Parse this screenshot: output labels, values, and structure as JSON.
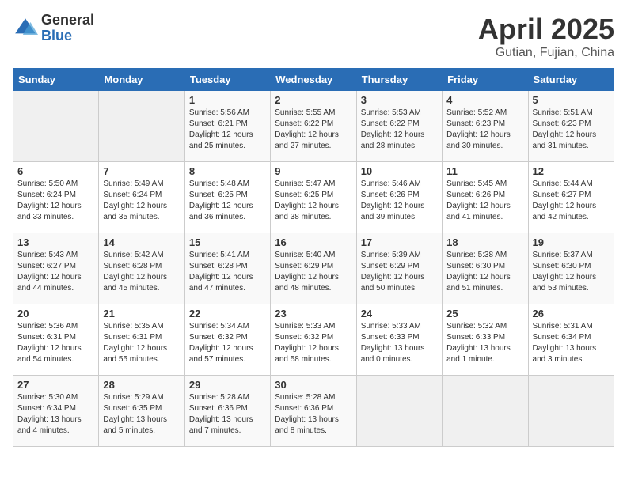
{
  "header": {
    "logo_general": "General",
    "logo_blue": "Blue",
    "month_title": "April 2025",
    "subtitle": "Gutian, Fujian, China"
  },
  "days_of_week": [
    "Sunday",
    "Monday",
    "Tuesday",
    "Wednesday",
    "Thursday",
    "Friday",
    "Saturday"
  ],
  "weeks": [
    [
      {
        "day": "",
        "info": ""
      },
      {
        "day": "",
        "info": ""
      },
      {
        "day": "1",
        "info": "Sunrise: 5:56 AM\nSunset: 6:21 PM\nDaylight: 12 hours and 25 minutes."
      },
      {
        "day": "2",
        "info": "Sunrise: 5:55 AM\nSunset: 6:22 PM\nDaylight: 12 hours and 27 minutes."
      },
      {
        "day": "3",
        "info": "Sunrise: 5:53 AM\nSunset: 6:22 PM\nDaylight: 12 hours and 28 minutes."
      },
      {
        "day": "4",
        "info": "Sunrise: 5:52 AM\nSunset: 6:23 PM\nDaylight: 12 hours and 30 minutes."
      },
      {
        "day": "5",
        "info": "Sunrise: 5:51 AM\nSunset: 6:23 PM\nDaylight: 12 hours and 31 minutes."
      }
    ],
    [
      {
        "day": "6",
        "info": "Sunrise: 5:50 AM\nSunset: 6:24 PM\nDaylight: 12 hours and 33 minutes."
      },
      {
        "day": "7",
        "info": "Sunrise: 5:49 AM\nSunset: 6:24 PM\nDaylight: 12 hours and 35 minutes."
      },
      {
        "day": "8",
        "info": "Sunrise: 5:48 AM\nSunset: 6:25 PM\nDaylight: 12 hours and 36 minutes."
      },
      {
        "day": "9",
        "info": "Sunrise: 5:47 AM\nSunset: 6:25 PM\nDaylight: 12 hours and 38 minutes."
      },
      {
        "day": "10",
        "info": "Sunrise: 5:46 AM\nSunset: 6:26 PM\nDaylight: 12 hours and 39 minutes."
      },
      {
        "day": "11",
        "info": "Sunrise: 5:45 AM\nSunset: 6:26 PM\nDaylight: 12 hours and 41 minutes."
      },
      {
        "day": "12",
        "info": "Sunrise: 5:44 AM\nSunset: 6:27 PM\nDaylight: 12 hours and 42 minutes."
      }
    ],
    [
      {
        "day": "13",
        "info": "Sunrise: 5:43 AM\nSunset: 6:27 PM\nDaylight: 12 hours and 44 minutes."
      },
      {
        "day": "14",
        "info": "Sunrise: 5:42 AM\nSunset: 6:28 PM\nDaylight: 12 hours and 45 minutes."
      },
      {
        "day": "15",
        "info": "Sunrise: 5:41 AM\nSunset: 6:28 PM\nDaylight: 12 hours and 47 minutes."
      },
      {
        "day": "16",
        "info": "Sunrise: 5:40 AM\nSunset: 6:29 PM\nDaylight: 12 hours and 48 minutes."
      },
      {
        "day": "17",
        "info": "Sunrise: 5:39 AM\nSunset: 6:29 PM\nDaylight: 12 hours and 50 minutes."
      },
      {
        "day": "18",
        "info": "Sunrise: 5:38 AM\nSunset: 6:30 PM\nDaylight: 12 hours and 51 minutes."
      },
      {
        "day": "19",
        "info": "Sunrise: 5:37 AM\nSunset: 6:30 PM\nDaylight: 12 hours and 53 minutes."
      }
    ],
    [
      {
        "day": "20",
        "info": "Sunrise: 5:36 AM\nSunset: 6:31 PM\nDaylight: 12 hours and 54 minutes."
      },
      {
        "day": "21",
        "info": "Sunrise: 5:35 AM\nSunset: 6:31 PM\nDaylight: 12 hours and 55 minutes."
      },
      {
        "day": "22",
        "info": "Sunrise: 5:34 AM\nSunset: 6:32 PM\nDaylight: 12 hours and 57 minutes."
      },
      {
        "day": "23",
        "info": "Sunrise: 5:33 AM\nSunset: 6:32 PM\nDaylight: 12 hours and 58 minutes."
      },
      {
        "day": "24",
        "info": "Sunrise: 5:33 AM\nSunset: 6:33 PM\nDaylight: 13 hours and 0 minutes."
      },
      {
        "day": "25",
        "info": "Sunrise: 5:32 AM\nSunset: 6:33 PM\nDaylight: 13 hours and 1 minute."
      },
      {
        "day": "26",
        "info": "Sunrise: 5:31 AM\nSunset: 6:34 PM\nDaylight: 13 hours and 3 minutes."
      }
    ],
    [
      {
        "day": "27",
        "info": "Sunrise: 5:30 AM\nSunset: 6:34 PM\nDaylight: 13 hours and 4 minutes."
      },
      {
        "day": "28",
        "info": "Sunrise: 5:29 AM\nSunset: 6:35 PM\nDaylight: 13 hours and 5 minutes."
      },
      {
        "day": "29",
        "info": "Sunrise: 5:28 AM\nSunset: 6:36 PM\nDaylight: 13 hours and 7 minutes."
      },
      {
        "day": "30",
        "info": "Sunrise: 5:28 AM\nSunset: 6:36 PM\nDaylight: 13 hours and 8 minutes."
      },
      {
        "day": "",
        "info": ""
      },
      {
        "day": "",
        "info": ""
      },
      {
        "day": "",
        "info": ""
      }
    ]
  ]
}
